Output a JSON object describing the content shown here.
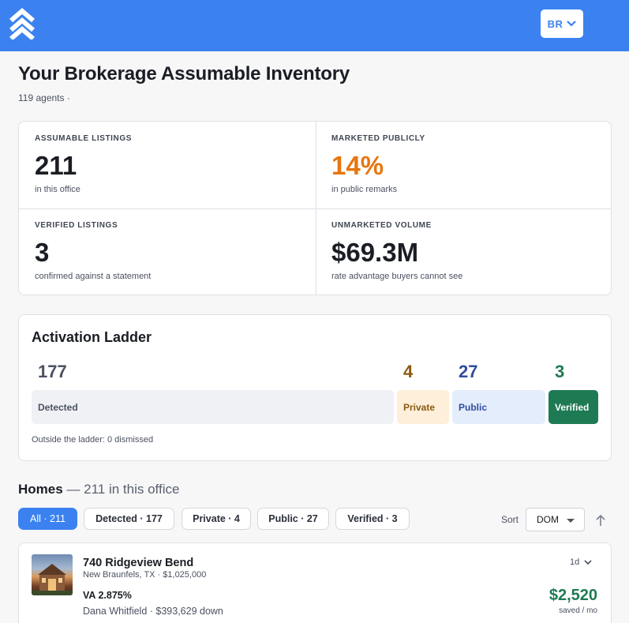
{
  "header": {
    "logo_icon": "chevron-stack-logo-icon",
    "user_initials": "BR",
    "accent": "#3b82f0"
  },
  "page": {
    "title": "Your Brokerage Assumable Inventory",
    "subtitle": "119 agents ·"
  },
  "stats": {
    "assumable": {
      "label": "ASSUMABLE LISTINGS",
      "value": "211",
      "sub": "in this office"
    },
    "marketed": {
      "label": "MARKETED PUBLICLY",
      "value": "14%",
      "sub": "in public remarks"
    },
    "verified": {
      "label": "VERIFIED LISTINGS",
      "value": "3",
      "sub": "confirmed against a statement"
    },
    "unmarketed": {
      "label": "UNMARKETED VOLUME",
      "value": "$69.3M",
      "sub": "rate advantage buyers cannot see"
    }
  },
  "ladder": {
    "title": "Activation Ladder",
    "stages": [
      {
        "label": "Detected",
        "count": "177",
        "color": "#4b5160"
      },
      {
        "label": "Private",
        "count": "4",
        "color": "#8a5a12"
      },
      {
        "label": "Public",
        "count": "27",
        "color": "#2e4f9e"
      },
      {
        "label": "Verified",
        "count": "3",
        "color": "#1e7a53"
      }
    ],
    "footer": "Outside the ladder: 0 dismissed"
  },
  "homes": {
    "title": "Homes",
    "subtitle": "— 211 in this office",
    "filters": [
      {
        "label": "All · 211",
        "active": true
      },
      {
        "label": "Detected · 177",
        "active": false
      },
      {
        "label": "Private · 4",
        "active": false
      },
      {
        "label": "Public · 27",
        "active": false
      },
      {
        "label": "Verified · 3",
        "active": false
      }
    ],
    "sort_label": "Sort",
    "sort_value": "DOM",
    "sort_direction_icon": "arrow-up-icon",
    "listings": [
      {
        "address": "740 Ridgeview Bend",
        "location": "New Braunfels, TX · $1,025,000",
        "rate": "VA 2.875%",
        "agent": "Dana Whitfield · $393,629 down",
        "dom": "1d",
        "savings": "$2,520",
        "savings_label": "saved / mo"
      }
    ]
  }
}
